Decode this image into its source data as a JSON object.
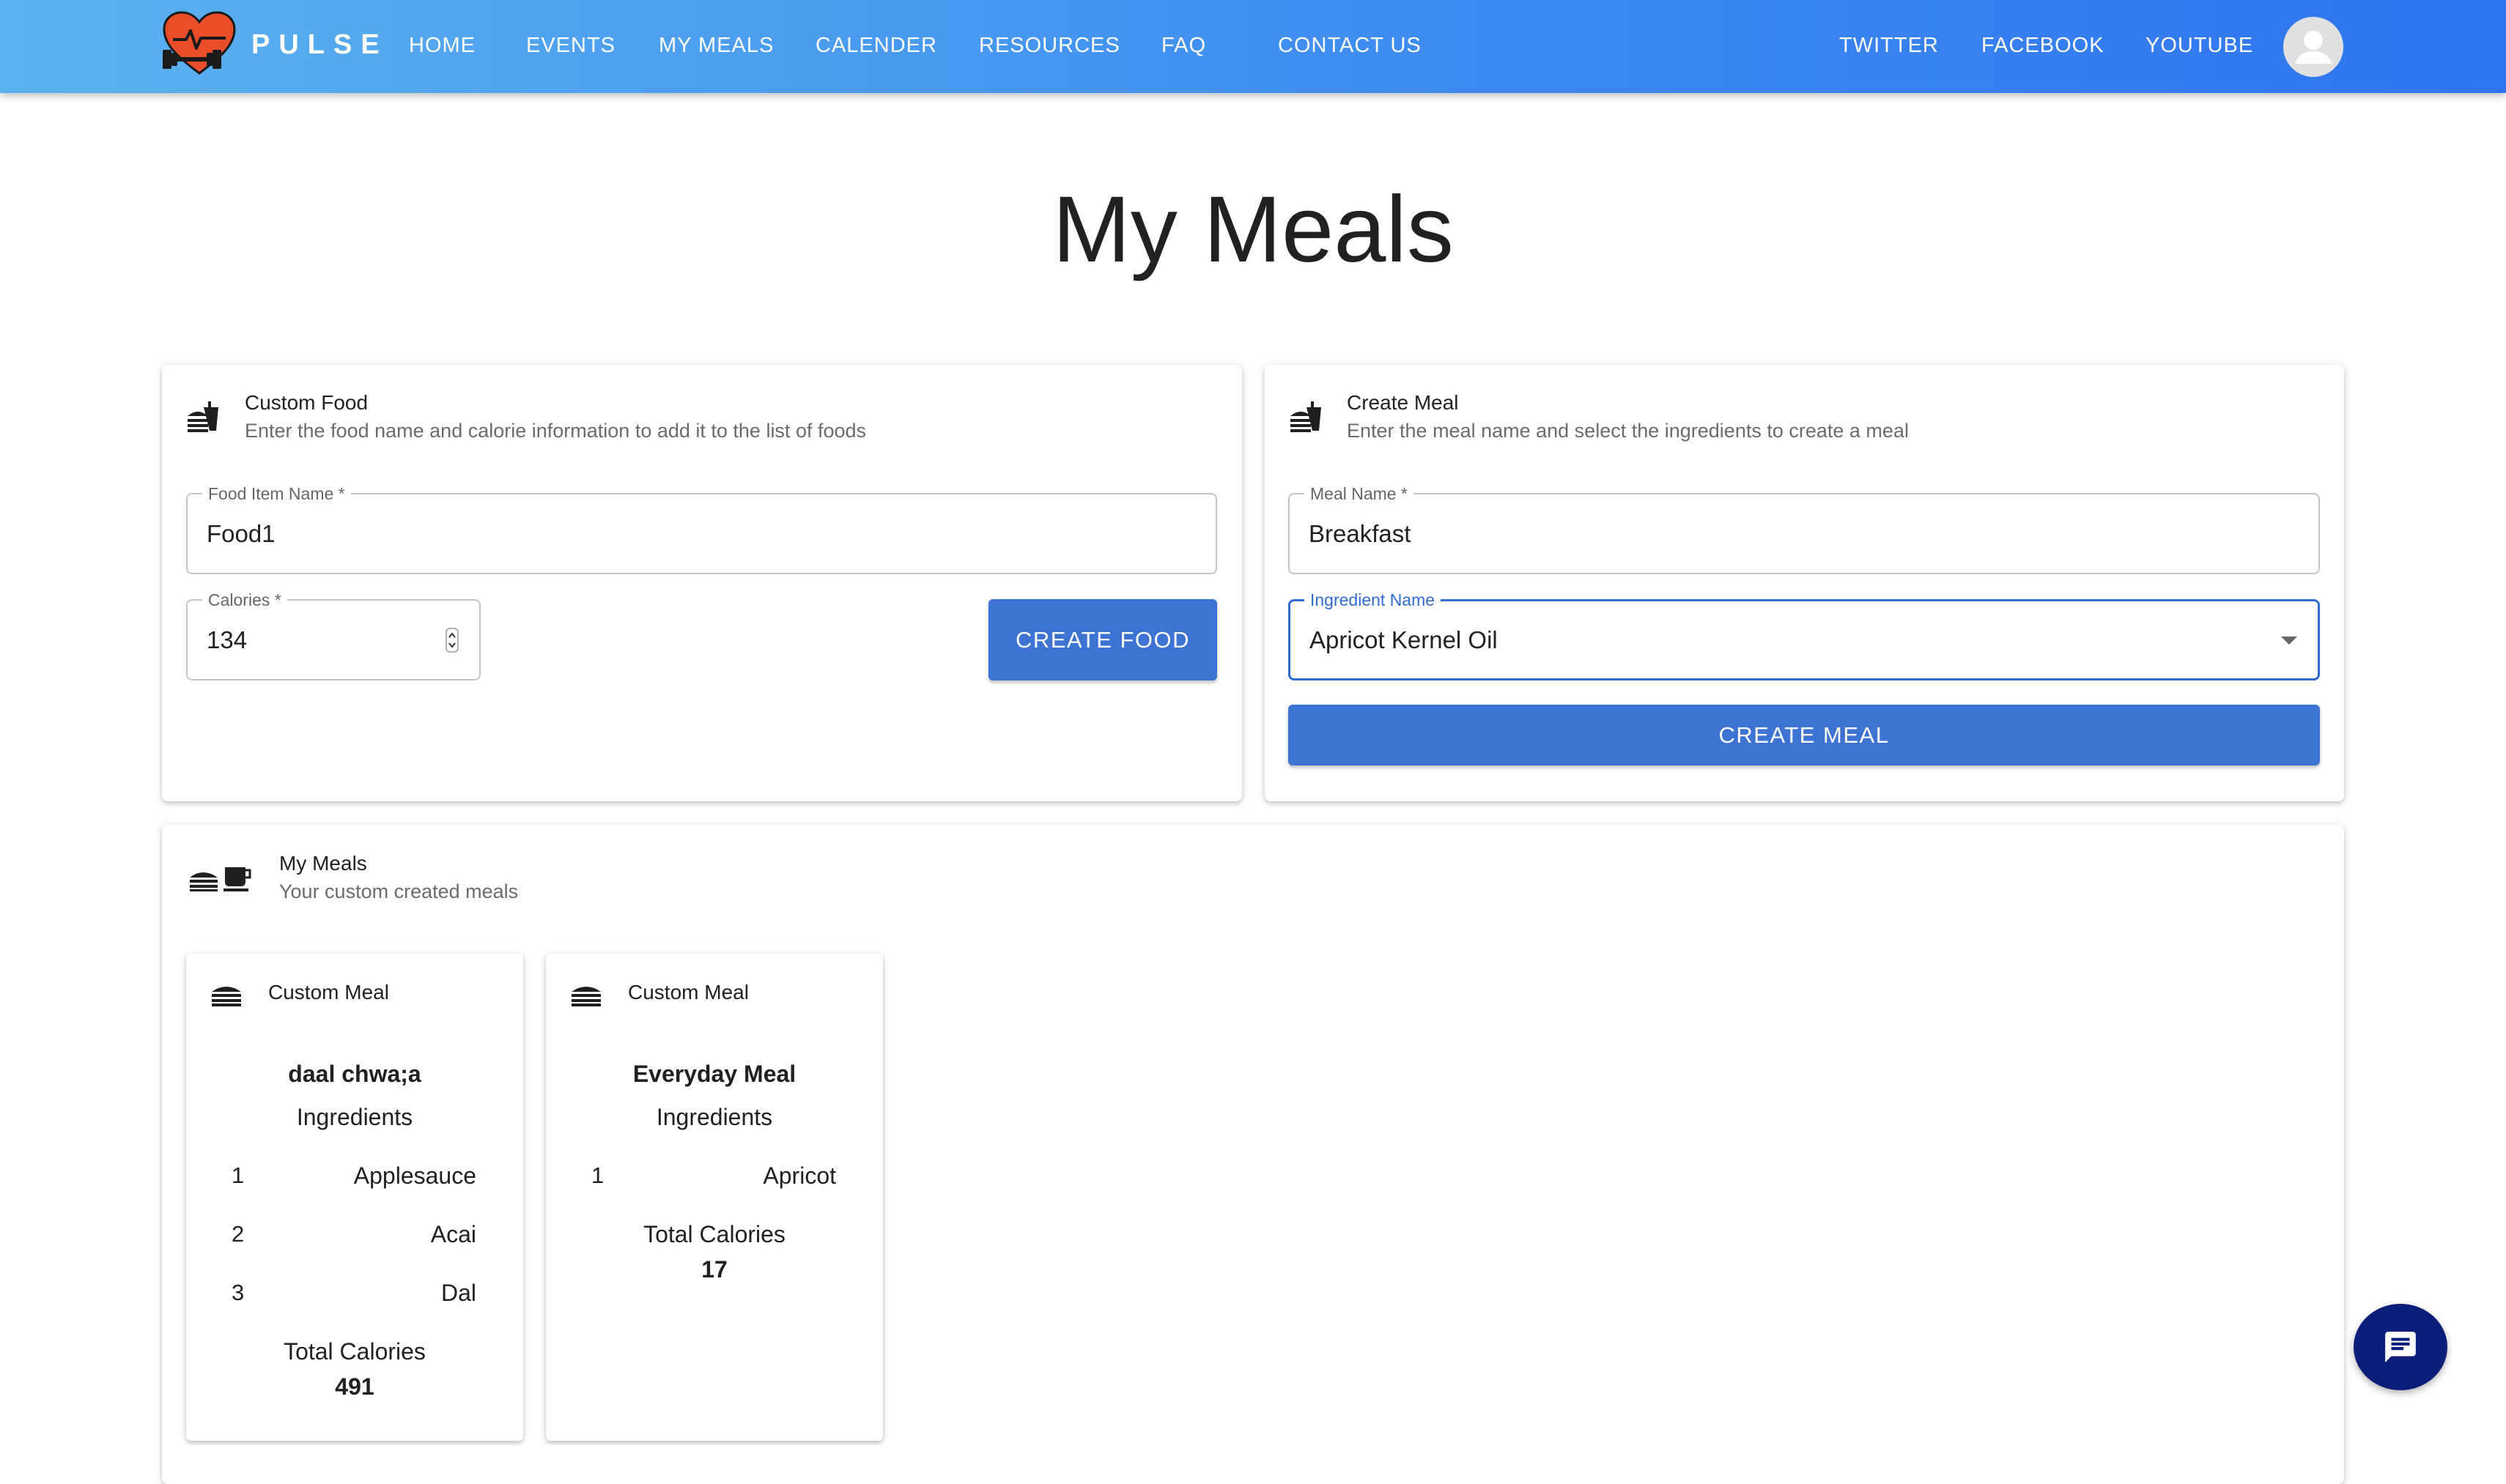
{
  "nav": {
    "brand": "PULSE",
    "links": [
      "HOME",
      "EVENTS",
      "MY MEALS",
      "CALENDER",
      "RESOURCES",
      "FAQ",
      "CONTACT US"
    ],
    "social": [
      "TWITTER",
      "FACEBOOK",
      "YOUTUBE"
    ]
  },
  "page_title": "My Meals",
  "custom_food": {
    "title": "Custom Food",
    "subtitle": "Enter the food name and calorie information to add it to the list of foods",
    "food_name_label": "Food Item Name *",
    "food_name_value": "Food1",
    "calories_label": "Calories *",
    "calories_value": "134",
    "button": "CREATE FOOD"
  },
  "create_meal": {
    "title": "Create Meal",
    "subtitle": "Enter the meal name and select the ingredients to create a meal",
    "meal_name_label": "Meal Name *",
    "meal_name_value": "Breakfast",
    "ingredient_label": "Ingredient Name",
    "ingredient_value": "Apricot Kernel Oil",
    "button": "CREATE MEAL"
  },
  "my_meals": {
    "title": "My Meals",
    "subtitle": "Your custom created meals",
    "meals": [
      {
        "kind": "Custom Meal",
        "name": "daal chwa;a",
        "ingredients_label": "Ingredients",
        "ingredients": [
          {
            "num": "1",
            "name": "Applesauce"
          },
          {
            "num": "2",
            "name": "Acai"
          },
          {
            "num": "3",
            "name": "Dal"
          }
        ],
        "total_label": "Total Calories",
        "total": "491"
      },
      {
        "kind": "Custom Meal",
        "name": "Everyday Meal",
        "ingredients_label": "Ingredients",
        "ingredients": [
          {
            "num": "1",
            "name": "Apricot"
          }
        ],
        "total_label": "Total Calories",
        "total": "17"
      }
    ]
  },
  "icons": {
    "logo": "heart-dumbbell-logo-icon",
    "food": "fastfood-icon",
    "meals": "burger-coffee-icon",
    "meal": "burger-icon",
    "avatar": "account-circle-icon",
    "chat": "chat-icon",
    "dropdown": "arrow-drop-down-icon",
    "stepper": "spin-stepper-icon"
  },
  "colors": {
    "nav_gradient_start": "#5cb2ee",
    "nav_gradient_end": "#2f74f0",
    "button": "#3d73d2",
    "focus": "#2f6bd0",
    "chat_fab": "#0b1e7a",
    "logo_heart": "#e94e2a"
  }
}
